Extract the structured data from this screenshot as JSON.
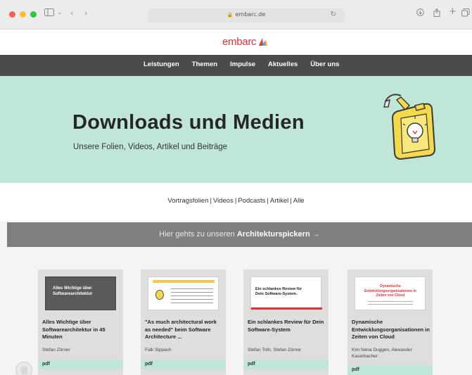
{
  "browser": {
    "url": "embarc.de",
    "traffic_light_colors": [
      "#ff5f57",
      "#febc2e",
      "#28c840"
    ],
    "icons": [
      "sidebar-icon",
      "back-icon",
      "forward-icon",
      "reload-icon",
      "download-icon",
      "share-icon",
      "new-tab-icon",
      "tabs-icon"
    ]
  },
  "site": {
    "logo_text": "embarc",
    "brand_color": "#e3313a",
    "nav": [
      "Leistungen",
      "Themen",
      "Impulse",
      "Aktuelles",
      "Über uns"
    ]
  },
  "hero": {
    "title": "Downloads und Medien",
    "subtitle": "Unsere Folien, Videos, Artikel und Beiträge",
    "background": "#bfe6d6"
  },
  "filters": {
    "items": [
      "Vortragsfolien",
      "Videos",
      "Podcasts",
      "Artikel",
      "Alle"
    ],
    "separator": "|"
  },
  "banner": {
    "text_prefix": "Hier gehts zu unseren",
    "text_strong": "Architekturspickern",
    "arrow": "→"
  },
  "cards": [
    {
      "title": "Alles Wichtige über Softwarearchitektur in 45 Minuten",
      "author": "Stefan Zörner",
      "type": "pdf",
      "thumb_title": "Alles Wichtige über Softwarearchitektur"
    },
    {
      "title": "\"As much architectural work as needed\" beim Software Architecture ...",
      "author": "Falk Sippach",
      "type": "pdf",
      "thumb_title": ""
    },
    {
      "title": "Ein schlankes Review für Dein Software-System",
      "author": "Stefan Toth, Stefan Zörner",
      "type": "pdf",
      "thumb_title": "Ein schlankes Review für Dein Software-System."
    },
    {
      "title": "Dynamische Entwicklungsorganisationen in Zeiten von Cloud",
      "author": "Kim Nena Duggen, Alexander Kaserbacher",
      "type": "pdf",
      "thumb_title": "Dynamische Entwicklungsorganisationen in Zeiten von Cloud"
    }
  ]
}
